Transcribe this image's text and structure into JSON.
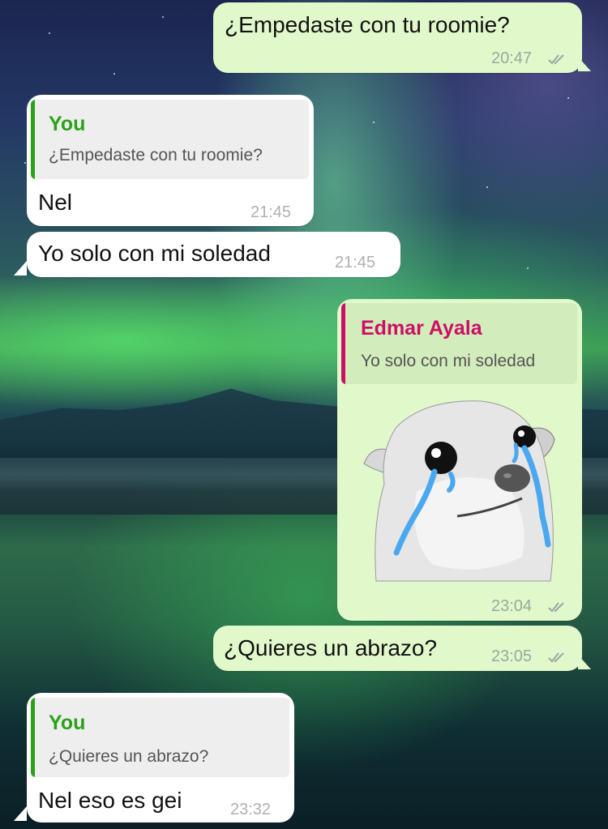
{
  "colors": {
    "outgoing_bubble": "#e1f8cb",
    "incoming_bubble": "#ffffff",
    "you_accent": "#2aa218",
    "contact_accent": "#cc0f66"
  },
  "messages": [
    {
      "direction": "outgoing",
      "text": "¿Empedaste con tu roomie?",
      "time": "20:47",
      "status": "double-check-icon"
    },
    {
      "direction": "incoming",
      "reply_name": "You",
      "reply_text": "¿Empedaste con tu roomie?",
      "text": "Nel",
      "time": "21:45"
    },
    {
      "direction": "incoming",
      "text": "Yo solo con mi soledad",
      "time": "21:45"
    },
    {
      "direction": "outgoing",
      "reply_name": "Edmar Ayala",
      "reply_text": "Yo solo con mi soledad",
      "sticker": "crying-chihuahua-sticker",
      "time": "23:04",
      "status": "double-check-icon"
    },
    {
      "direction": "outgoing",
      "text": "¿Quieres un abrazo?",
      "time": "23:05",
      "status": "double-check-icon"
    },
    {
      "direction": "incoming",
      "reply_name": "You",
      "reply_text": "¿Quieres un abrazo?",
      "text": "Nel eso es gei",
      "time": "23:32"
    }
  ]
}
